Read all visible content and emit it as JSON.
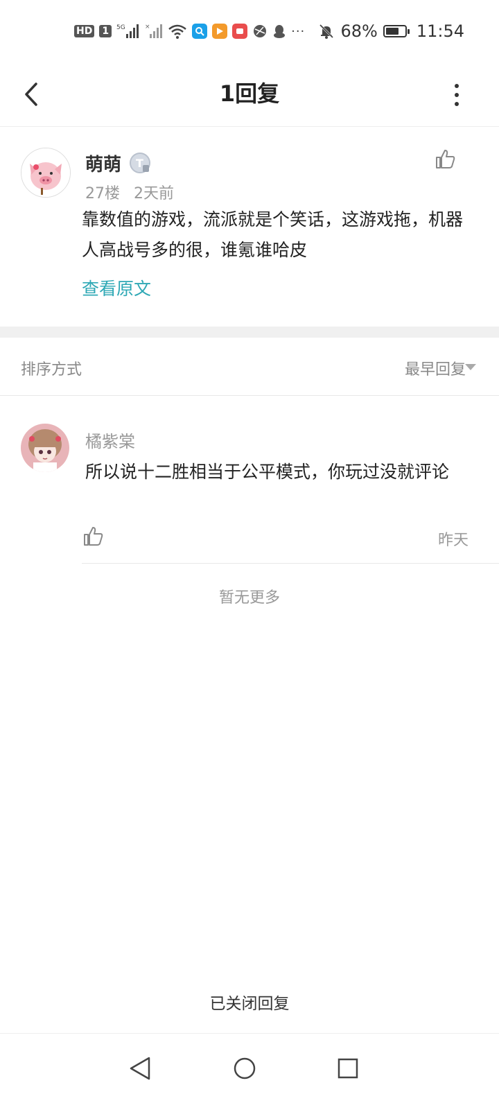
{
  "status_bar": {
    "hd": "HD",
    "sim": "1",
    "network": "5G",
    "battery_text": "68%",
    "battery_level": 0.68,
    "time": "11:54",
    "more": "···"
  },
  "header": {
    "title": "1回复"
  },
  "post": {
    "username": "萌萌",
    "level_badge": "T",
    "floor": "27楼",
    "time": "2天前",
    "content": "靠数值的游戏，流派就是个笑话，这游戏拖，机器人高战号多的很，谁氪谁哈皮",
    "view_original": "查看原文"
  },
  "sort": {
    "label": "排序方式",
    "value": "最早回复"
  },
  "reply": {
    "username": "橘紫棠",
    "content": "所以说十二胜相当于公平模式，你玩过没就评论",
    "time": "昨天"
  },
  "no_more": "暂无更多",
  "closed_text": "已关闭回复",
  "colors": {
    "accent": "#2ea8b5",
    "divider": "#f0f0f0"
  }
}
